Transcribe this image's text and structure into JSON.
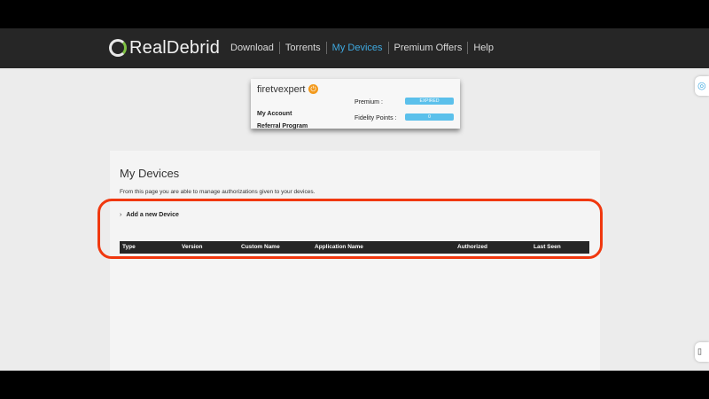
{
  "brand": {
    "name": "RealDebrid"
  },
  "nav": [
    {
      "label": "Download"
    },
    {
      "label": "Torrents"
    },
    {
      "label": "My Devices"
    },
    {
      "label": "Premium Offers"
    },
    {
      "label": "Help"
    }
  ],
  "account": {
    "username": "firetvexpert",
    "links": [
      "My Account",
      "Referral Program"
    ],
    "premium_label": "Premium :",
    "premium_value": "EXPIRED",
    "fidelity_label": "Fidelity Points :",
    "fidelity_value": "0"
  },
  "page": {
    "title": "My Devices",
    "description": "From this page you are able to manage authorizations given to your devices.",
    "add_device": "Add a new Device"
  },
  "table": {
    "columns": [
      "Type",
      "Version",
      "Custom Name",
      "Application Name",
      "Authorized",
      "Last Seen"
    ]
  },
  "icons": {
    "logo": "logo-ring-icon",
    "badge": "power-icon",
    "chevron": "chevron-right-icon",
    "side_top": "assistant-icon",
    "side_bottom": "book-icon"
  },
  "colors": {
    "navbar": "#262626",
    "active_nav": "#3fa9e0",
    "pill": "#5bc0eb",
    "highlight": "#f0380f",
    "badge": "#f29a1e"
  }
}
